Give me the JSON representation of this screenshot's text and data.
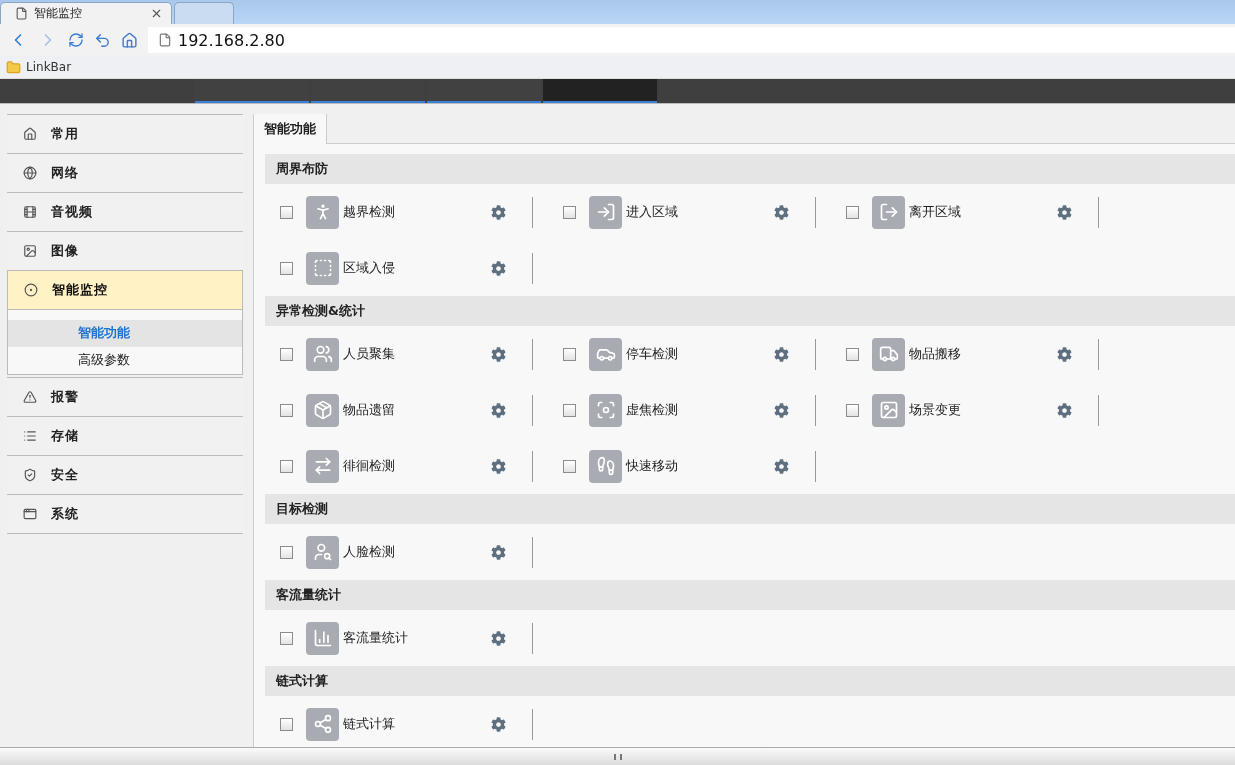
{
  "browser": {
    "tabs": [
      {
        "title": "智能监控",
        "selected": true
      },
      {
        "selected": false
      }
    ],
    "address": "192.168.2.80",
    "bookmarks": [
      {
        "label": "LinkBar"
      }
    ]
  },
  "top_nav": {
    "tabs": [
      {
        "selected": false
      },
      {
        "selected": false
      },
      {
        "selected": false
      },
      {
        "selected": true
      }
    ]
  },
  "sidebar": {
    "items": [
      {
        "label": "常用",
        "selected": false,
        "expanded": false
      },
      {
        "label": "网络",
        "selected": false,
        "expanded": false
      },
      {
        "label": "音视频",
        "selected": false,
        "expanded": false
      },
      {
        "label": "图像",
        "selected": false,
        "expanded": false
      },
      {
        "label": "智能监控",
        "selected": true,
        "expanded": true,
        "children": [
          {
            "label": "智能功能",
            "selected": true
          },
          {
            "label": "高级参数",
            "selected": false
          }
        ]
      },
      {
        "label": "报警",
        "selected": false,
        "expanded": false
      },
      {
        "label": "存储",
        "selected": false,
        "expanded": false
      },
      {
        "label": "安全",
        "selected": false,
        "expanded": false
      },
      {
        "label": "系统",
        "selected": false,
        "expanded": false
      }
    ]
  },
  "content": {
    "tabs": [
      {
        "label": "智能功能",
        "selected": true
      }
    ],
    "sections": [
      {
        "title": "周界布防",
        "items": [
          {
            "label": "越界检测",
            "kind": "walk",
            "checked": false
          },
          {
            "label": "进入区域",
            "kind": "enter",
            "checked": false
          },
          {
            "label": "离开区域",
            "kind": "exit",
            "checked": false
          },
          {
            "label": "区域入侵",
            "kind": "intrude",
            "checked": false
          }
        ]
      },
      {
        "title": "异常检测&统计",
        "items": [
          {
            "label": "人员聚集",
            "kind": "people",
            "checked": false
          },
          {
            "label": "停车检测",
            "kind": "car",
            "checked": false
          },
          {
            "label": "物品搬移",
            "kind": "truck",
            "checked": false
          },
          {
            "label": "物品遗留",
            "kind": "box",
            "checked": false
          },
          {
            "label": "虚焦检测",
            "kind": "focus",
            "checked": false
          },
          {
            "label": "场景变更",
            "kind": "scene",
            "checked": false
          },
          {
            "label": "徘徊检测",
            "kind": "wander",
            "checked": false
          },
          {
            "label": "快速移动",
            "kind": "run",
            "checked": false
          }
        ]
      },
      {
        "title": "目标检测",
        "items": [
          {
            "label": "人脸检测",
            "kind": "face",
            "checked": false
          }
        ]
      },
      {
        "title": "客流量统计",
        "items": [
          {
            "label": "客流量统计",
            "kind": "chart",
            "checked": false
          }
        ]
      },
      {
        "title": "链式计算",
        "items": [
          {
            "label": "链式计算",
            "kind": "share",
            "checked": false
          }
        ]
      }
    ]
  }
}
